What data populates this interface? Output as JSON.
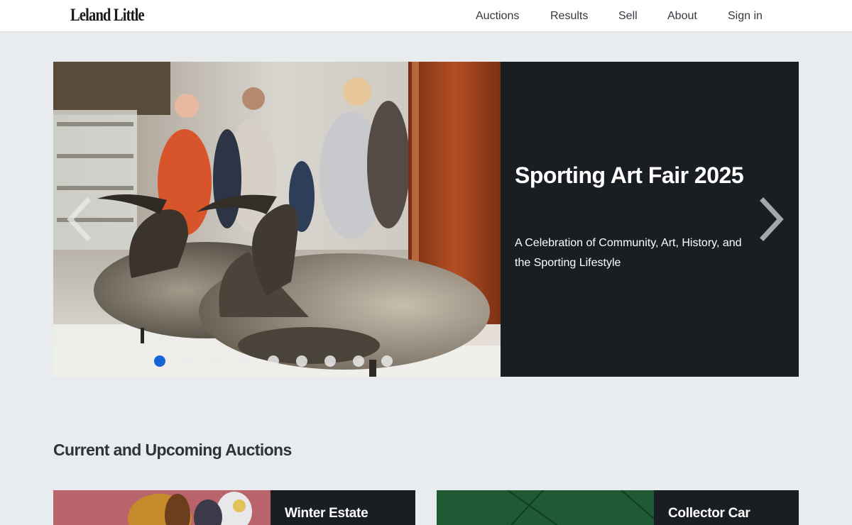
{
  "header": {
    "logo": "Leland Little",
    "nav": {
      "auctions": "Auctions",
      "results": "Results",
      "sell": "Sell",
      "about": "About",
      "sign_in": "Sign in"
    }
  },
  "hero": {
    "title": "Sporting Art Fair 2025",
    "subtitle": "A Celebration of Community, Art, History, and the Sporting Lifestyle",
    "prev_icon": "chevron-left-icon",
    "next_icon": "chevron-right-icon",
    "slide_count": 9,
    "active_slide": 1
  },
  "section": {
    "title": "Current and Upcoming Auctions"
  },
  "cards": [
    {
      "title": "Winter Estate"
    },
    {
      "title": "Collector Car"
    }
  ],
  "colors": {
    "panel": "#1a1e23",
    "page_bg": "#e9ecef",
    "active_dot": "#1565d8"
  }
}
